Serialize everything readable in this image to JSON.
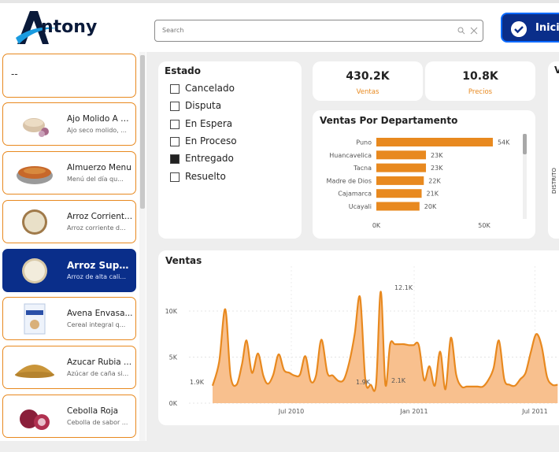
{
  "header": {
    "logo_text": "ntony",
    "search_placeholder": "Search",
    "inicio_label": "Inicio"
  },
  "products": [
    {
      "title": "--",
      "desc": ""
    },
    {
      "title": "Ajo Molido A G...",
      "desc": "Ajo seco molido, ...",
      "icon": "garlic-bowl-icon"
    },
    {
      "title": "Almuerzo Menu",
      "desc": "Menú del día qu...",
      "icon": "rice-dish-icon"
    },
    {
      "title": "Arroz Corrient...",
      "desc": "Arroz corriente d...",
      "icon": "rice-bowl-icon"
    },
    {
      "title": "Arroz Supe...",
      "desc": "Arroz de alta cali...",
      "icon": "rice-bowl-icon",
      "selected": true
    },
    {
      "title": "Avena Envasa...",
      "desc": "Cereal integral q...",
      "icon": "oats-package-icon"
    },
    {
      "title": "Azucar Rubia ...",
      "desc": "Azúcar de caña si...",
      "icon": "sugar-pile-icon"
    },
    {
      "title": "Cebolla Roja",
      "desc": "Cebolla de sabor ...",
      "icon": "red-onion-icon"
    }
  ],
  "estado": {
    "title": "Estado",
    "options": [
      {
        "label": "Cancelado",
        "checked": false
      },
      {
        "label": "Disputa",
        "checked": false
      },
      {
        "label": "En Espera",
        "checked": false
      },
      {
        "label": "En Proceso",
        "checked": false
      },
      {
        "label": "Entregado",
        "checked": true
      },
      {
        "label": "Resuelto",
        "checked": false
      }
    ]
  },
  "kpis": [
    {
      "value": "430.2K",
      "label": "Ventas"
    },
    {
      "value": "10.8K",
      "label": "Precios"
    }
  ],
  "edge_panel": {
    "title": "V",
    "side_label": "DISTRITO"
  },
  "colors": {
    "accent": "#e8891f",
    "brand": "#0a2e8a",
    "area_fill": "#f8c08e"
  },
  "chart_data": [
    {
      "type": "bar",
      "title": "Ventas Por Departamento",
      "orientation": "horizontal",
      "categories": [
        "Puno",
        "Huancavelica",
        "Tacna",
        "Madre de Dios",
        "Cajamarca",
        "Ucayali"
      ],
      "values": [
        54000,
        23000,
        23000,
        22000,
        21000,
        20000
      ],
      "value_labels": [
        "54K",
        "23K",
        "23K",
        "22K",
        "21K",
        "20K"
      ],
      "xticks": [
        "0K",
        "50K"
      ],
      "xlim": [
        0,
        60000
      ]
    },
    {
      "type": "area",
      "title": "Ventas",
      "yticks": [
        "0K",
        "5K",
        "10K"
      ],
      "xticks": [
        "Jul 2010",
        "Jan 2011",
        "Jul 2011"
      ],
      "ylim": [
        0,
        14000
      ],
      "annotations": [
        "1.9K",
        "1.9K",
        "2.1K",
        "12.1K"
      ],
      "x": [
        "2010-03-05",
        "2010-03-15",
        "2010-03-24",
        "2010-04-01",
        "2010-04-10",
        "2010-04-18",
        "2010-04-25",
        "2010-05-03",
        "2010-05-12",
        "2010-05-20",
        "2010-05-27",
        "2010-06-04",
        "2010-06-12",
        "2010-06-20",
        "2010-06-28",
        "2010-07-06",
        "2010-07-14",
        "2010-07-22",
        "2010-07-30",
        "2010-08-07",
        "2010-08-15",
        "2010-08-24",
        "2010-09-01",
        "2010-09-10",
        "2010-09-18",
        "2010-09-26",
        "2010-10-04",
        "2010-10-12",
        "2010-10-20",
        "2010-10-28",
        "2010-11-05",
        "2010-11-12",
        "2010-11-19",
        "2010-11-26",
        "2010-12-03",
        "2010-12-10",
        "2010-12-17",
        "2010-12-24",
        "2010-12-31",
        "2011-01-08",
        "2011-01-16",
        "2011-01-24",
        "2011-02-01",
        "2011-02-09",
        "2011-02-17",
        "2011-02-25",
        "2011-03-05",
        "2011-03-13",
        "2011-03-21",
        "2011-03-29",
        "2011-04-06",
        "2011-04-14",
        "2011-04-22",
        "2011-04-30",
        "2011-05-08",
        "2011-05-16",
        "2011-05-24",
        "2011-06-01",
        "2011-06-09",
        "2011-06-17",
        "2011-06-25",
        "2011-07-03",
        "2011-07-11",
        "2011-07-19",
        "2011-07-27",
        "2011-08-04"
      ],
      "values": [
        1900,
        4500,
        10200,
        3000,
        2000,
        4200,
        6800,
        3300,
        5400,
        3000,
        2100,
        3100,
        5300,
        3600,
        3300,
        3000,
        3100,
        5100,
        2400,
        3000,
        6900,
        3300,
        3000,
        2400,
        2600,
        4500,
        7500,
        11500,
        2500,
        2000,
        2100,
        12100,
        2000,
        6400,
        6400,
        6400,
        6400,
        6300,
        6300,
        6300,
        2500,
        4000,
        1900,
        5600,
        1500,
        7100,
        3100,
        1800,
        1800,
        1800,
        1800,
        1800,
        2500,
        3800,
        6800,
        2600,
        2000,
        1900,
        2600,
        3300,
        5600,
        7500,
        6200,
        2900,
        2000,
        2000
      ]
    }
  ]
}
